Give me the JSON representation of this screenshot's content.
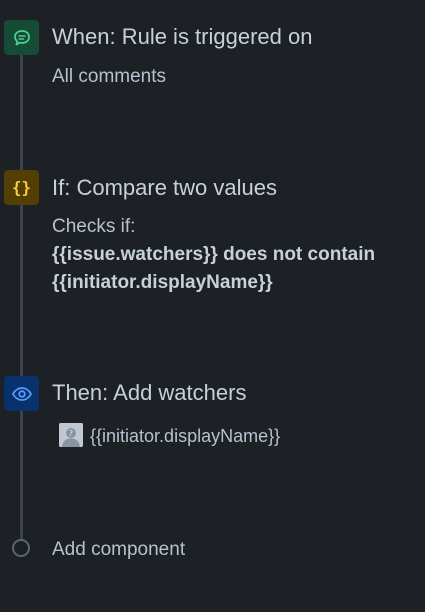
{
  "trigger": {
    "icon": "comment-icon",
    "title": "When: Rule is triggered on",
    "detail": "All comments"
  },
  "condition": {
    "icon": "curly-braces-icon",
    "title": "If: Compare two values",
    "checks_label": "Checks if:",
    "line1": "{{issue.watchers}} does not contain",
    "line2": "{{initiator.displayName}}"
  },
  "action": {
    "icon": "eye-icon",
    "title": "Then: Add watchers",
    "watcher": "{{initiator.displayName}}"
  },
  "add_component": {
    "label": "Add component"
  },
  "colors": {
    "background": "#1d2125",
    "trigger_icon_bg": "#164b35",
    "condition_icon_bg": "#533f04",
    "action_icon_bg": "#09326c"
  }
}
